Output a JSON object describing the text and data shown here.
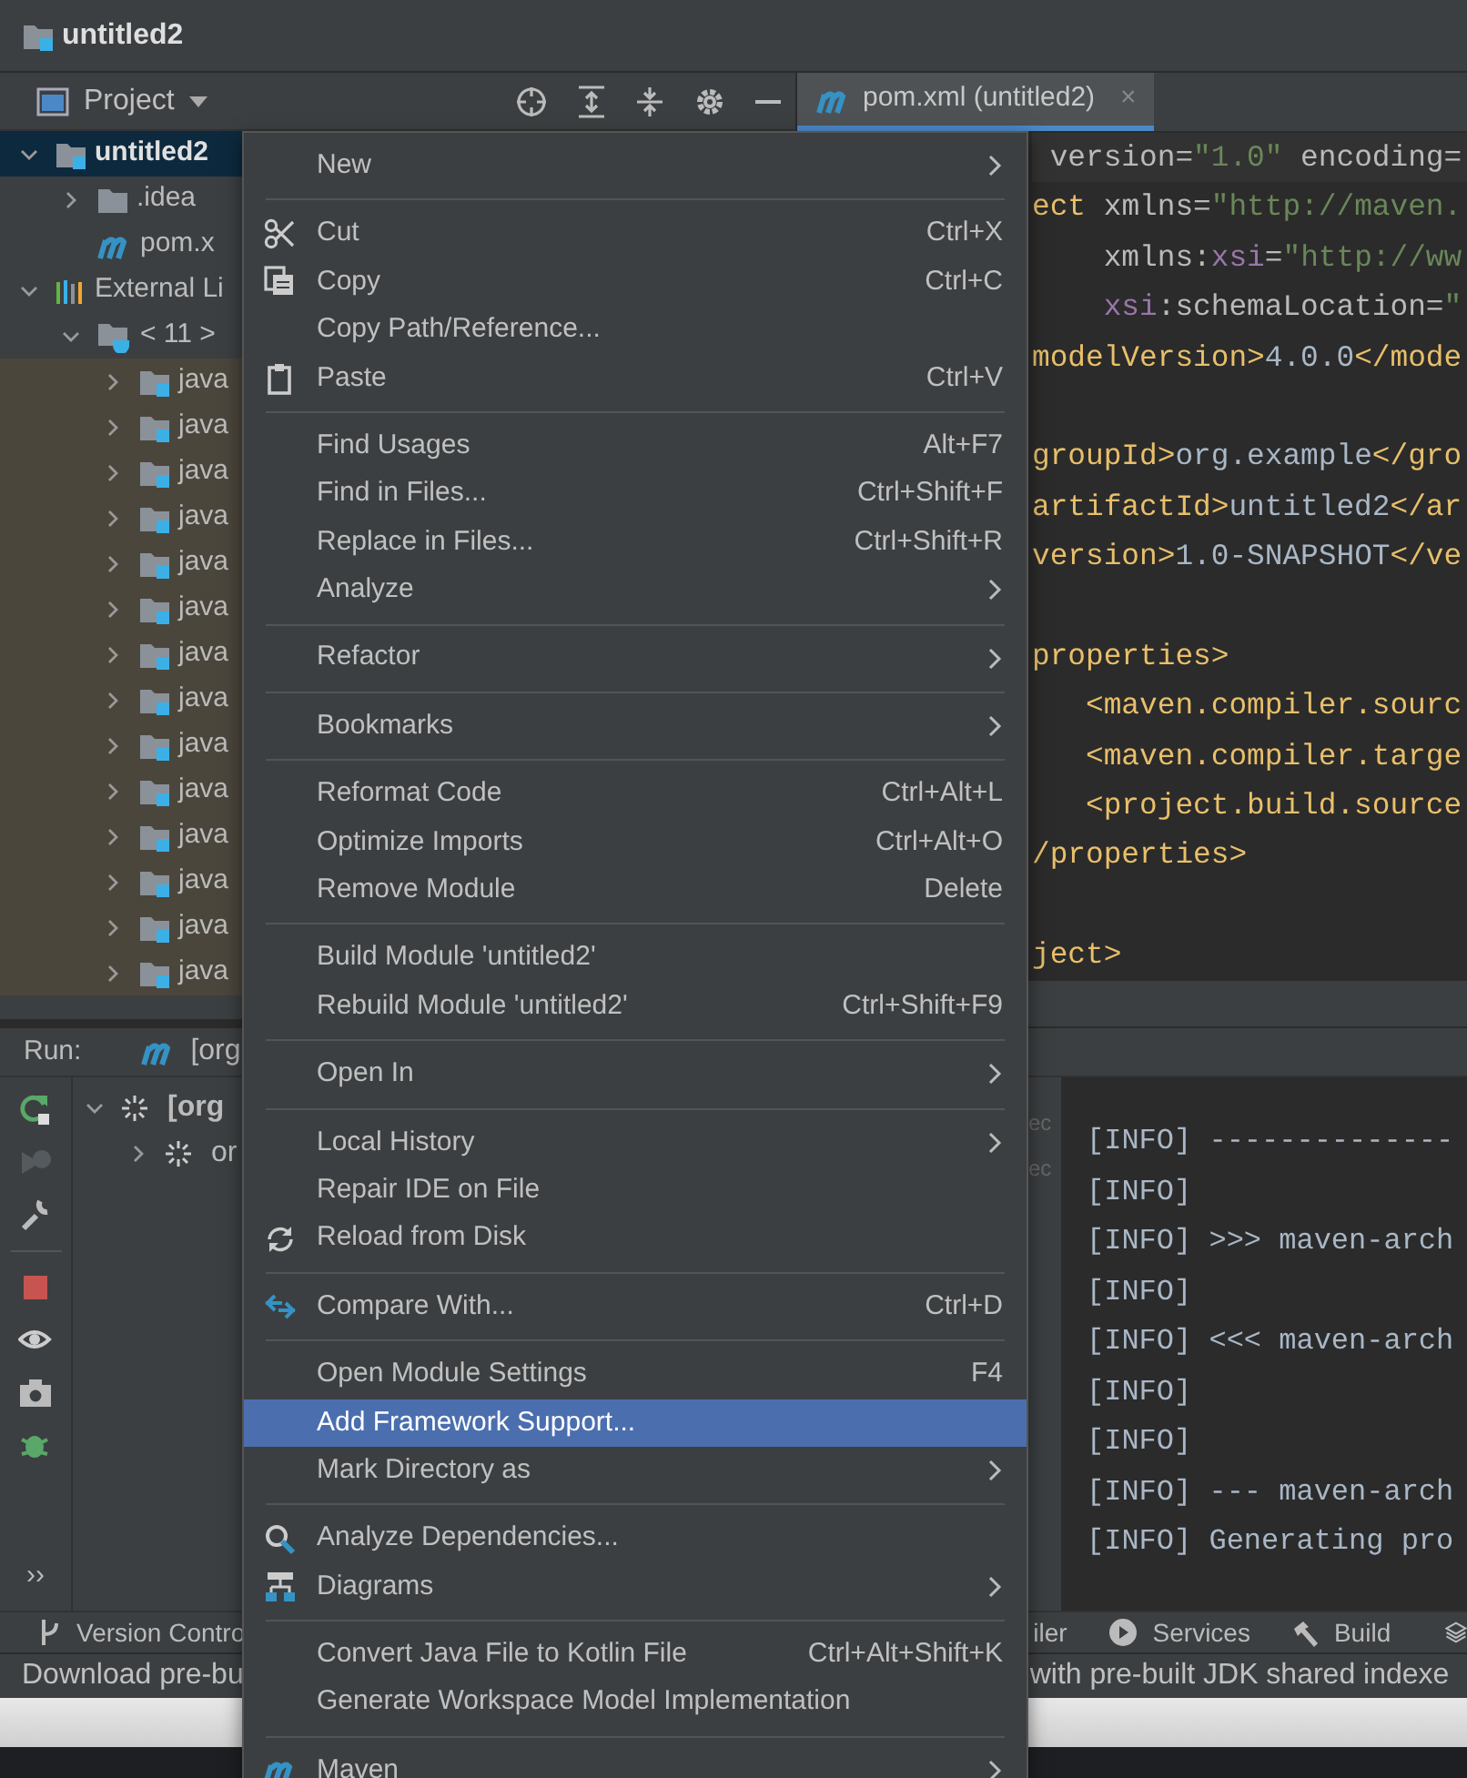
{
  "window": {
    "title": "untitled2"
  },
  "project_panel": {
    "title": "Project",
    "tree": [
      {
        "label": "untitled2",
        "kind": "module",
        "expanded": true,
        "selected": true,
        "children": [
          {
            "label": ".idea",
            "kind": "folder",
            "expanded": false,
            "selected": false
          },
          {
            "label": "pom.x",
            "kind": "maven",
            "selected": false
          }
        ]
      },
      {
        "label": "External Li",
        "kind": "libraries",
        "expanded": true,
        "selected": false,
        "children": [
          {
            "label": "< 11 >",
            "kind": "sdk",
            "expanded": true,
            "selected": false,
            "children": [
              {
                "label": "java",
                "kind": "package",
                "expanded": false,
                "selected": false
              },
              {
                "label": "java",
                "kind": "package",
                "expanded": false,
                "selected": false
              },
              {
                "label": "java",
                "kind": "package",
                "expanded": false,
                "selected": false
              },
              {
                "label": "java",
                "kind": "package",
                "expanded": false,
                "selected": false
              },
              {
                "label": "java",
                "kind": "package",
                "expanded": false,
                "selected": false
              },
              {
                "label": "java",
                "kind": "package",
                "expanded": false,
                "selected": false
              },
              {
                "label": "java",
                "kind": "package",
                "expanded": false,
                "selected": false
              },
              {
                "label": "java",
                "kind": "package",
                "expanded": false,
                "selected": false
              },
              {
                "label": "java",
                "kind": "package",
                "expanded": false,
                "selected": false
              },
              {
                "label": "java",
                "kind": "package",
                "expanded": false,
                "selected": false
              },
              {
                "label": "java",
                "kind": "package",
                "expanded": false,
                "selected": false
              },
              {
                "label": "java",
                "kind": "package",
                "expanded": false,
                "selected": false
              },
              {
                "label": "java",
                "kind": "package",
                "expanded": false,
                "selected": false
              },
              {
                "label": "java",
                "kind": "package",
                "expanded": false,
                "selected": false
              }
            ]
          }
        ]
      }
    ]
  },
  "editor": {
    "tab": {
      "label": "pom.xml (untitled2)",
      "close": "×",
      "selected": true
    },
    "lines": [
      {
        "kind": "code",
        "segments": [
          {
            "kind": "attr",
            "text": " version="
          },
          {
            "kind": "value",
            "text": "\"1.0\""
          },
          {
            "kind": "attr",
            "text": " encoding="
          }
        ]
      },
      {
        "kind": "code",
        "segments": [
          {
            "kind": "tag",
            "text": "ect"
          },
          {
            "kind": "attr",
            "text": " xmlns="
          },
          {
            "kind": "value",
            "text": "\"http://maven."
          }
        ]
      },
      {
        "kind": "code",
        "segments": [
          {
            "kind": "attr",
            "text": "    xmlns:"
          },
          {
            "kind": "ns",
            "text": "xsi"
          },
          {
            "kind": "attr",
            "text": "="
          },
          {
            "kind": "value",
            "text": "\"http://ww"
          }
        ]
      },
      {
        "kind": "code",
        "segments": [
          {
            "kind": "ns",
            "text": "    xsi"
          },
          {
            "kind": "attr",
            "text": ":schemaLocation="
          },
          {
            "kind": "value",
            "text": "\""
          }
        ]
      },
      {
        "kind": "code",
        "segments": [
          {
            "kind": "tag",
            "text": "modelVersion>"
          },
          {
            "kind": "text",
            "text": "4.0.0"
          },
          {
            "kind": "tag",
            "text": "</mode"
          }
        ]
      },
      {
        "kind": "blank"
      },
      {
        "kind": "code",
        "segments": [
          {
            "kind": "tag",
            "text": "groupId>"
          },
          {
            "kind": "text",
            "text": "org.example"
          },
          {
            "kind": "tag",
            "text": "</gro"
          }
        ]
      },
      {
        "kind": "code",
        "segments": [
          {
            "kind": "tag",
            "text": "artifactId>"
          },
          {
            "kind": "text",
            "text": "untitled2"
          },
          {
            "kind": "tag",
            "text": "</ar"
          }
        ]
      },
      {
        "kind": "code",
        "segments": [
          {
            "kind": "tag",
            "text": "version>"
          },
          {
            "kind": "text",
            "text": "1.0-SNAPSHOT"
          },
          {
            "kind": "tag",
            "text": "</ve"
          }
        ]
      },
      {
        "kind": "blank"
      },
      {
        "kind": "code",
        "segments": [
          {
            "kind": "tag",
            "text": "properties>"
          }
        ]
      },
      {
        "kind": "code",
        "segments": [
          {
            "kind": "tag",
            "text": "   <maven.compiler.sourc"
          }
        ]
      },
      {
        "kind": "code",
        "segments": [
          {
            "kind": "tag",
            "text": "   <maven.compiler.targe"
          }
        ]
      },
      {
        "kind": "code",
        "segments": [
          {
            "kind": "tag",
            "text": "   <project.build.source"
          }
        ]
      },
      {
        "kind": "code",
        "segments": [
          {
            "kind": "tag",
            "text": "/properties>"
          }
        ]
      },
      {
        "kind": "blank"
      },
      {
        "kind": "code",
        "segments": [
          {
            "kind": "tag",
            "text": "ject>"
          }
        ]
      }
    ]
  },
  "run_panel": {
    "title": "Run:",
    "tab_label": "[org",
    "tree": [
      {
        "label": "[org",
        "expanded": true,
        "children": [
          {
            "label": "or",
            "expanded": false
          }
        ]
      }
    ],
    "gutter": [
      "ec",
      "ec"
    ],
    "console": [
      "[INFO] --------------",
      "[INFO]",
      "[INFO] >>> maven-arch",
      "[INFO]",
      "[INFO] <<< maven-arch",
      "[INFO]",
      "[INFO]",
      "[INFO] --- maven-arch",
      "[INFO] Generating pro"
    ],
    "more": "››"
  },
  "tool_strip": [
    {
      "label": "Version Contro"
    },
    {
      "label": "iler"
    },
    {
      "label": "Services"
    },
    {
      "label": "Build"
    }
  ],
  "status_bar": {
    "left": "Download pre-bu",
    "right": "with pre-built JDK shared indexe"
  },
  "context_menu": [
    {
      "kind": "item",
      "label": "New",
      "submenu": true,
      "selected": false
    },
    {
      "kind": "separator"
    },
    {
      "kind": "item",
      "label": "Cut",
      "shortcut": "Ctrl+X",
      "selected": false
    },
    {
      "kind": "item",
      "label": "Copy",
      "shortcut": "Ctrl+C",
      "selected": false
    },
    {
      "kind": "item",
      "label": "Copy Path/Reference...",
      "selected": false
    },
    {
      "kind": "item",
      "label": "Paste",
      "shortcut": "Ctrl+V",
      "selected": false
    },
    {
      "kind": "separator"
    },
    {
      "kind": "item",
      "label": "Find Usages",
      "shortcut": "Alt+F7",
      "selected": false
    },
    {
      "kind": "item",
      "label": "Find in Files...",
      "shortcut": "Ctrl+Shift+F",
      "selected": false
    },
    {
      "kind": "item",
      "label": "Replace in Files...",
      "shortcut": "Ctrl+Shift+R",
      "selected": false
    },
    {
      "kind": "item",
      "label": "Analyze",
      "submenu": true,
      "selected": false
    },
    {
      "kind": "separator"
    },
    {
      "kind": "item",
      "label": "Refactor",
      "submenu": true,
      "selected": false
    },
    {
      "kind": "separator"
    },
    {
      "kind": "item",
      "label": "Bookmarks",
      "submenu": true,
      "selected": false
    },
    {
      "kind": "separator"
    },
    {
      "kind": "item",
      "label": "Reformat Code",
      "shortcut": "Ctrl+Alt+L",
      "selected": false
    },
    {
      "kind": "item",
      "label": "Optimize Imports",
      "shortcut": "Ctrl+Alt+O",
      "selected": false
    },
    {
      "kind": "item",
      "label": "Remove Module",
      "shortcut": "Delete",
      "selected": false
    },
    {
      "kind": "separator"
    },
    {
      "kind": "item",
      "label": "Build Module 'untitled2'",
      "selected": false
    },
    {
      "kind": "item",
      "label": "Rebuild Module 'untitled2'",
      "shortcut": "Ctrl+Shift+F9",
      "selected": false
    },
    {
      "kind": "separator"
    },
    {
      "kind": "item",
      "label": "Open In",
      "submenu": true,
      "selected": false
    },
    {
      "kind": "separator"
    },
    {
      "kind": "item",
      "label": "Local History",
      "submenu": true,
      "selected": false
    },
    {
      "kind": "item",
      "label": "Repair IDE on File",
      "selected": false
    },
    {
      "kind": "item",
      "label": "Reload from Disk",
      "selected": false
    },
    {
      "kind": "separator"
    },
    {
      "kind": "item",
      "label": "Compare With...",
      "shortcut": "Ctrl+D",
      "selected": false
    },
    {
      "kind": "separator"
    },
    {
      "kind": "item",
      "label": "Open Module Settings",
      "shortcut": "F4",
      "selected": false
    },
    {
      "kind": "item",
      "label": "Add Framework Support...",
      "selected": true
    },
    {
      "kind": "item",
      "label": "Mark Directory as",
      "submenu": true,
      "selected": false
    },
    {
      "kind": "separator"
    },
    {
      "kind": "item",
      "label": "Analyze Dependencies...",
      "selected": false
    },
    {
      "kind": "item",
      "label": "Diagrams",
      "submenu": true,
      "selected": false
    },
    {
      "kind": "separator"
    },
    {
      "kind": "item",
      "label": "Convert Java File to Kotlin File",
      "shortcut": "Ctrl+Alt+Shift+K",
      "selected": false
    },
    {
      "kind": "item",
      "label": "Generate Workspace Model Implementation",
      "selected": false
    },
    {
      "kind": "separator"
    },
    {
      "kind": "item",
      "label": "Maven",
      "submenu": true,
      "selected": false
    }
  ]
}
